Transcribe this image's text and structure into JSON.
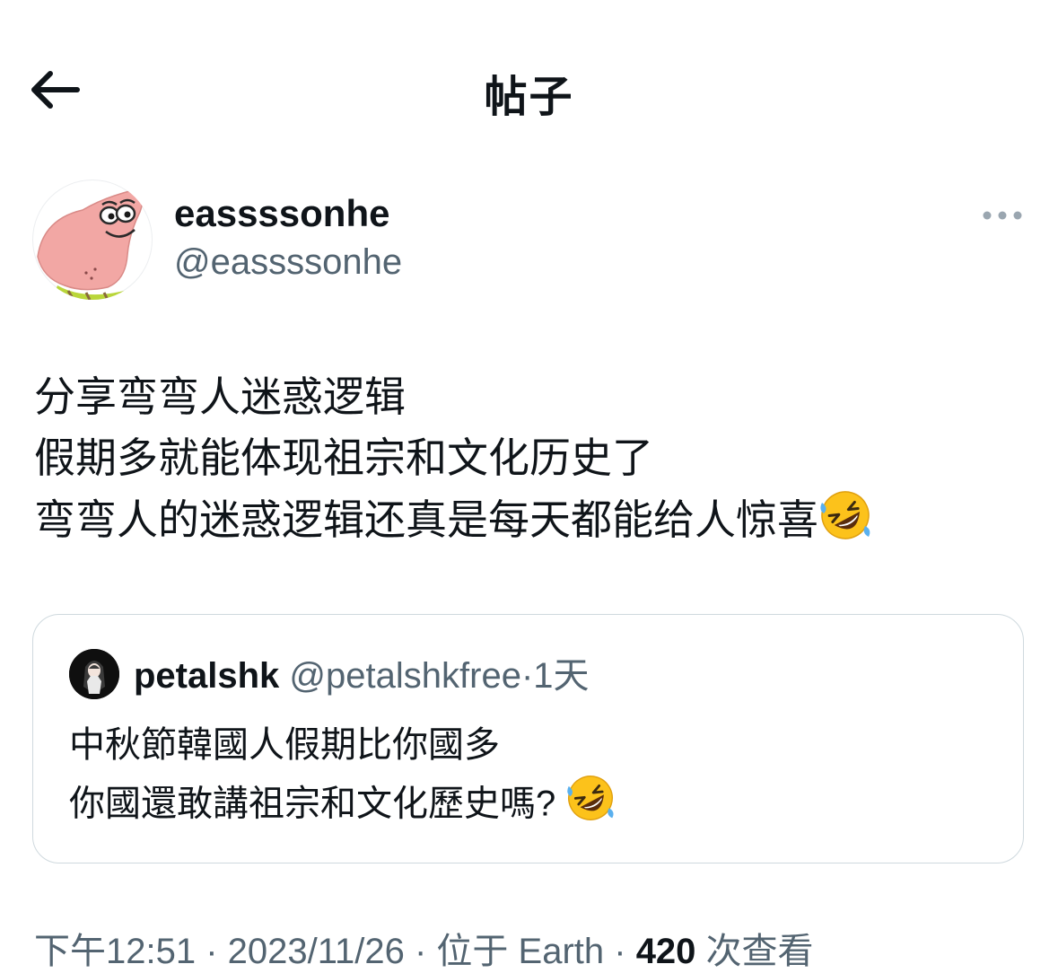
{
  "header": {
    "title": "帖子",
    "back_icon": "arrow-left-icon"
  },
  "author": {
    "display_name": "eassssonhe",
    "handle": "@eassssonhe",
    "avatar_icon": "patrick-star-avatar",
    "more_icon": "more-horizontal-icon"
  },
  "post": {
    "lines": [
      "分享弯弯人迷惑逻辑",
      "假期多就能体现祖宗和文化历史了",
      "弯弯人的迷惑逻辑还真是每天都能给人惊喜"
    ],
    "trailing_emoji": "rolling-on-floor-laughing-emoji"
  },
  "quote": {
    "name": "petalshk",
    "handle": "@petalshkfree",
    "dot": "·",
    "time": "1天",
    "lines": [
      "中秋節韓國人假期比你國多",
      "你國還敢講祖宗和文化歷史嗎?"
    ],
    "trailing_emoji": "rolling-on-floor-laughing-emoji"
  },
  "meta": {
    "time_text": "下午12:51 · 2023/11/26 · 位于 Earth · ",
    "views": "420",
    "views_label": " 次查看"
  },
  "colors": {
    "text_primary": "#0f1419",
    "text_secondary": "#536471",
    "border": "#cfd9de"
  }
}
